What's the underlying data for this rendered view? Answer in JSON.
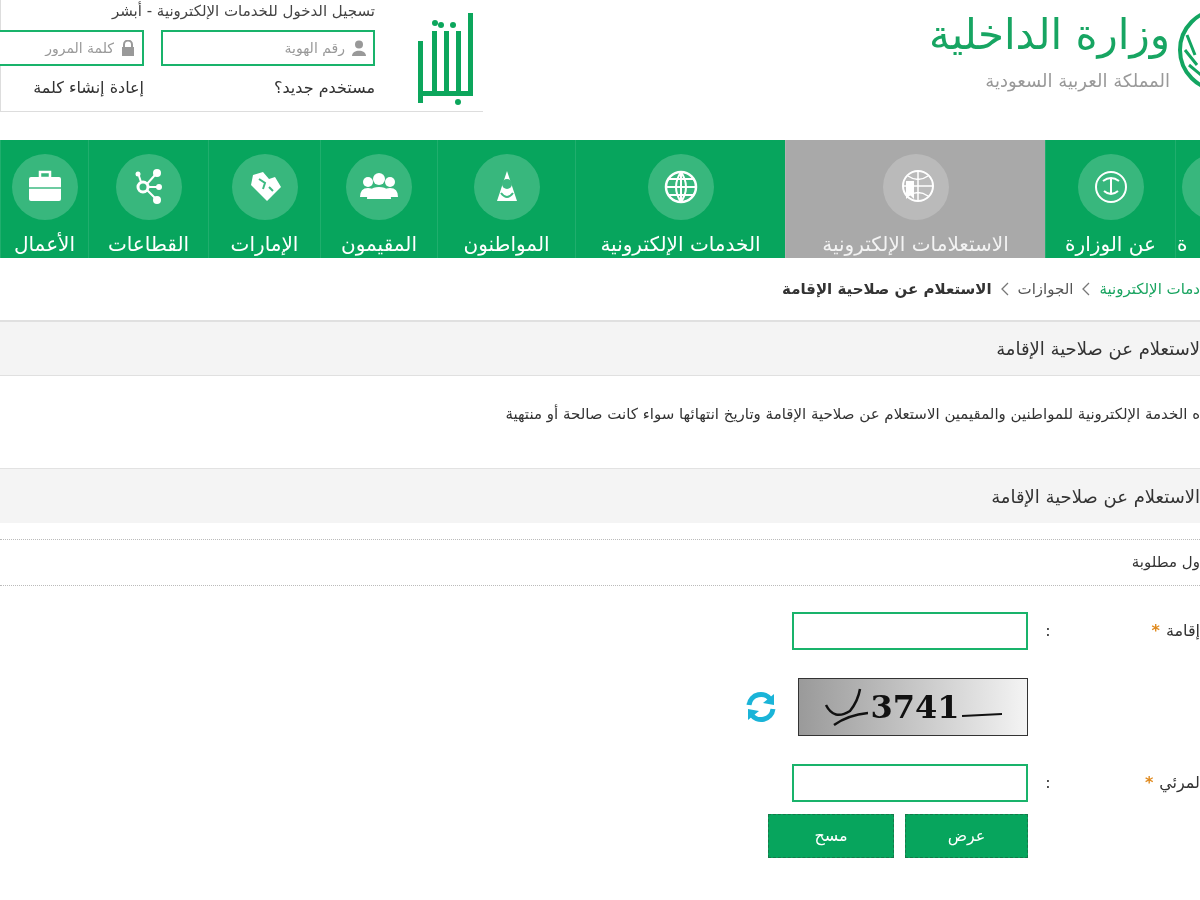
{
  "header": {
    "ministry_name": "وزارة الداخلية",
    "country": "المملكة العربية السعودية"
  },
  "login": {
    "title": "تسجيل الدخول للخدمات الإلكترونية - أبشر",
    "id_field": {
      "placeholder": "رقم الهوية"
    },
    "password_field": {
      "placeholder": "كلمة المرور"
    },
    "new_user_link": "مستخدم جديد؟",
    "reset_password_link": "إعادة إنشاء كلمة"
  },
  "nav": {
    "items": [
      {
        "label": "ة",
        "selected": false
      },
      {
        "label": "عن الوزارة",
        "selected": false
      },
      {
        "label": "الاستعلامات الإلكترونية",
        "selected": true
      },
      {
        "label": "الخدمات الإلكترونية",
        "selected": false
      },
      {
        "label": "المواطنون",
        "selected": false
      },
      {
        "label": "المقيمون",
        "selected": false
      },
      {
        "label": "الإمارات",
        "selected": false
      },
      {
        "label": "القطاعات",
        "selected": false
      },
      {
        "label": "الأعمال",
        "selected": false
      }
    ]
  },
  "breadcrumb": [
    {
      "label": "دمات الإلكترونية",
      "kind": "link"
    },
    {
      "label": "الجوازات",
      "kind": "link"
    },
    {
      "label": "الاستعلام عن صلاحية الإقامة",
      "kind": "current"
    }
  ],
  "page_header": "لاستعلام عن صلاحية الإقامة",
  "description": "ه الخدمة الإلكترونية للمواطنين والمقيمين الاستعلام عن صلاحية الإقامة وتاريخ انتهائها سواء كانت صالحة أو منتهية",
  "form": {
    "title": "الاستعلام عن صلاحية الإقامة",
    "required_note": "ول مطلوبة",
    "fields": [
      {
        "kind": "text",
        "label": "إقامة",
        "required_mark": "*",
        "separator": ":"
      },
      {
        "kind": "captcha",
        "captcha_text": "3741"
      },
      {
        "kind": "text",
        "label": "لمرئي",
        "required_mark": "*",
        "separator": ":"
      }
    ],
    "buttons": [
      {
        "label": "عرض"
      },
      {
        "label": "مسح"
      }
    ]
  }
}
